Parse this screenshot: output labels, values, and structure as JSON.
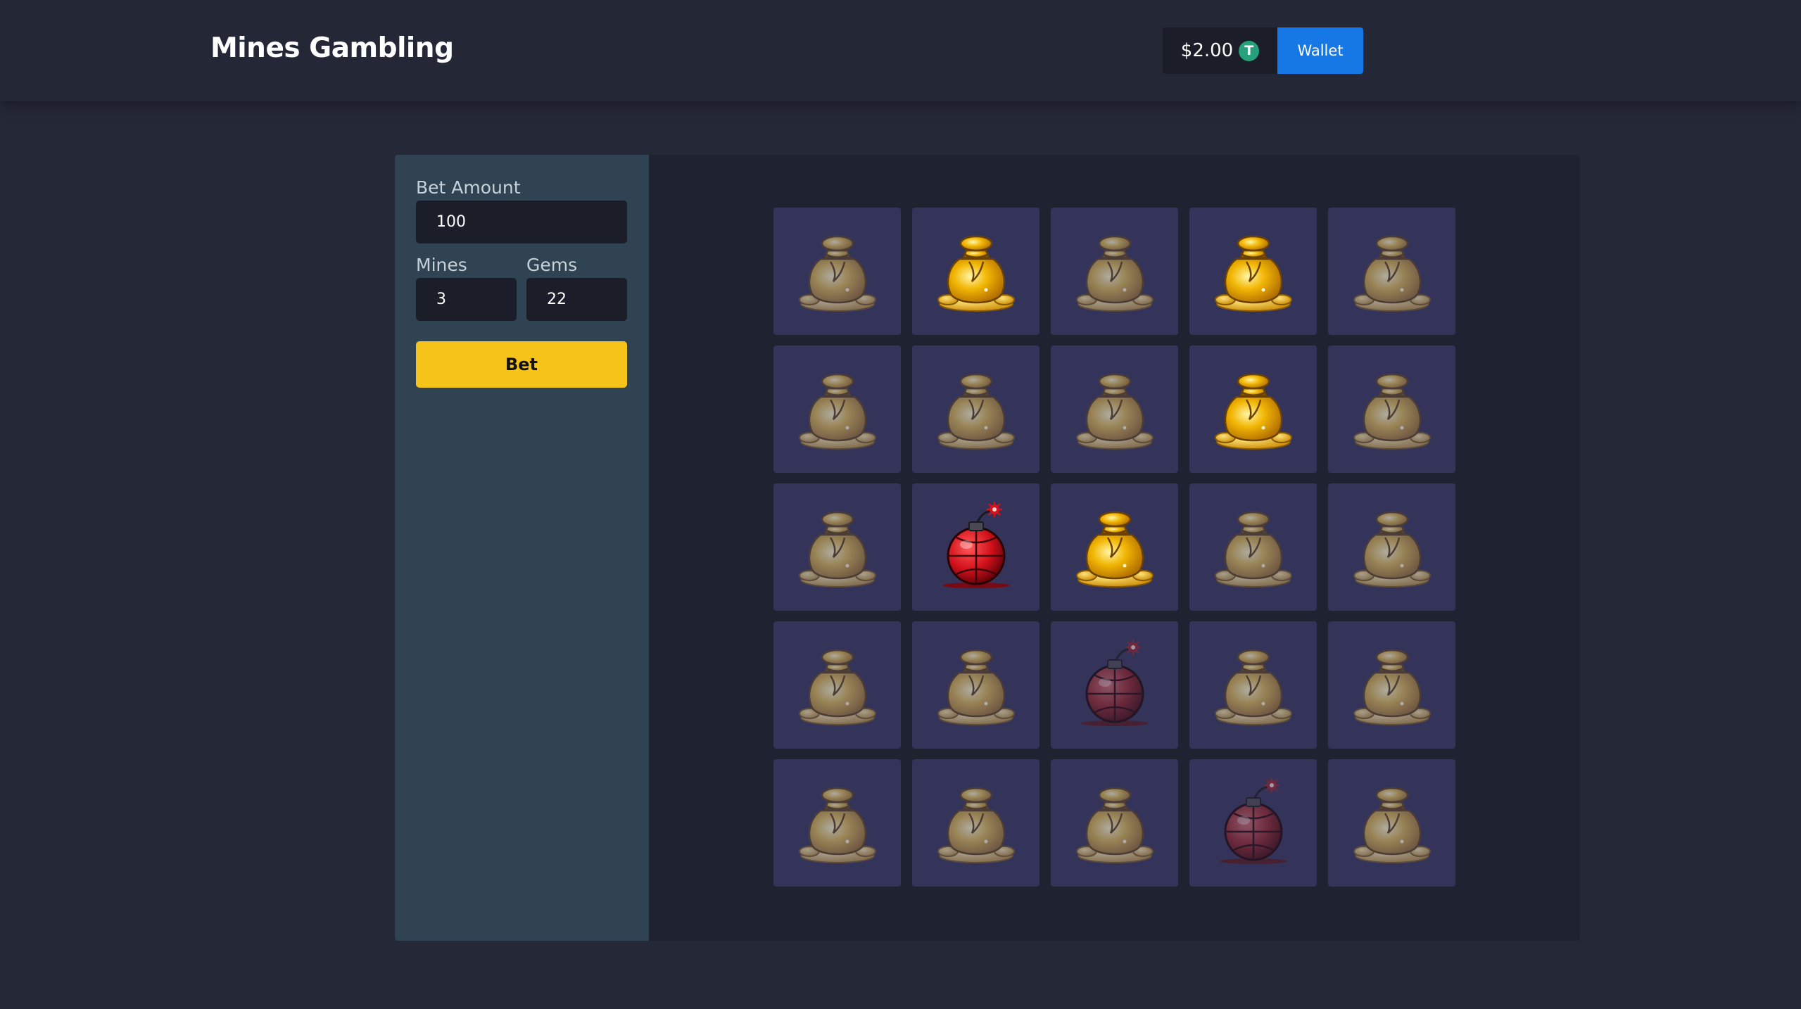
{
  "header": {
    "brand": "Mines Gambling",
    "balance": "$2.00",
    "currency_icon": "tether-icon",
    "currency_glyph": "T",
    "wallet_label": "Wallet"
  },
  "controls": {
    "bet_amount_label": "Bet Amount",
    "bet_amount_value": "100",
    "mines_label": "Mines",
    "mines_value": "3",
    "gems_label": "Gems",
    "gems_value": "22",
    "bet_label": "Bet"
  },
  "board": {
    "rows": 5,
    "cols": 5,
    "tiles": [
      {
        "type": "gem",
        "revealed": false
      },
      {
        "type": "gem",
        "revealed": true
      },
      {
        "type": "gem",
        "revealed": false
      },
      {
        "type": "gem",
        "revealed": true
      },
      {
        "type": "gem",
        "revealed": false
      },
      {
        "type": "gem",
        "revealed": false
      },
      {
        "type": "gem",
        "revealed": false
      },
      {
        "type": "gem",
        "revealed": false
      },
      {
        "type": "gem",
        "revealed": true
      },
      {
        "type": "gem",
        "revealed": false
      },
      {
        "type": "gem",
        "revealed": false
      },
      {
        "type": "mine",
        "revealed": true
      },
      {
        "type": "gem",
        "revealed": true
      },
      {
        "type": "gem",
        "revealed": false
      },
      {
        "type": "gem",
        "revealed": false
      },
      {
        "type": "gem",
        "revealed": false
      },
      {
        "type": "gem",
        "revealed": false
      },
      {
        "type": "mine",
        "revealed": false
      },
      {
        "type": "gem",
        "revealed": false
      },
      {
        "type": "gem",
        "revealed": false
      },
      {
        "type": "gem",
        "revealed": false
      },
      {
        "type": "gem",
        "revealed": false
      },
      {
        "type": "gem",
        "revealed": false
      },
      {
        "type": "mine",
        "revealed": false
      },
      {
        "type": "gem",
        "revealed": false
      }
    ]
  },
  "colors": {
    "accent_wallet": "#1578e5",
    "bet_button": "#f6c31b",
    "tile": "#34335a",
    "gold": "#f2b705",
    "mine_red": "#d3121c"
  }
}
